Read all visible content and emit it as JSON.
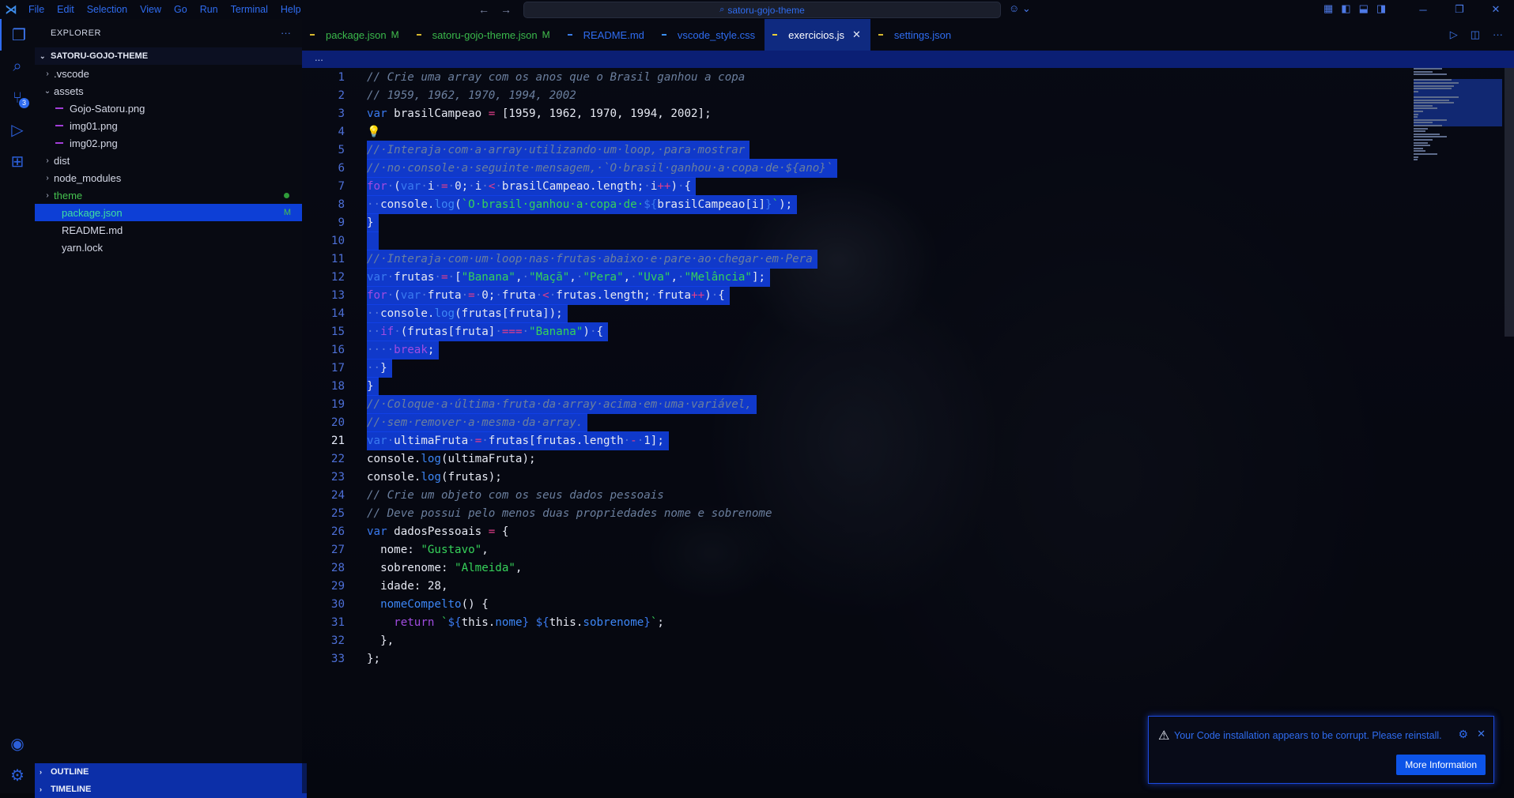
{
  "titlebar": {
    "menu": [
      "File",
      "Edit",
      "Selection",
      "View",
      "Go",
      "Run",
      "Terminal",
      "Help"
    ],
    "search": "satoru-gojo-theme"
  },
  "sidebar": {
    "title": "EXPLORER",
    "root": "SATORU-GOJO-THEME",
    "items": [
      {
        "label": ".vscode",
        "type": "folder",
        "depth": 0,
        "expanded": false
      },
      {
        "label": "assets",
        "type": "folder",
        "depth": 0,
        "expanded": true
      },
      {
        "label": "Gojo-Satoru.png",
        "type": "file",
        "depth": 1
      },
      {
        "label": "img01.png",
        "type": "file",
        "depth": 1
      },
      {
        "label": "img02.png",
        "type": "file",
        "depth": 1
      },
      {
        "label": "dist",
        "type": "folder",
        "depth": 0,
        "expanded": false
      },
      {
        "label": "node_modules",
        "type": "folder",
        "depth": 0,
        "expanded": false
      },
      {
        "label": "theme",
        "type": "folder",
        "depth": 0,
        "expanded": false,
        "modified": true
      },
      {
        "label": "package.json",
        "type": "file",
        "depth": 0,
        "status": "M",
        "selected": true
      },
      {
        "label": "README.md",
        "type": "file",
        "depth": 0
      },
      {
        "label": "yarn.lock",
        "type": "file",
        "depth": 0
      }
    ],
    "outline": "OUTLINE",
    "timeline": "TIMELINE"
  },
  "activity": {
    "scm_badge": "3"
  },
  "tabs": [
    {
      "label": "package.json",
      "status": "M",
      "kind": "json",
      "modified": true
    },
    {
      "label": "satoru-gojo-theme.json",
      "status": "M",
      "kind": "json",
      "modified": true
    },
    {
      "label": "README.md",
      "status": "",
      "kind": "md"
    },
    {
      "label": "vscode_style.css",
      "status": "",
      "kind": "css"
    },
    {
      "label": "exercicios.js",
      "status": "",
      "kind": "js",
      "active": true
    },
    {
      "label": "settings.json",
      "status": "",
      "kind": "json"
    }
  ],
  "breadcrumb": "...",
  "editor": {
    "current_line": 21,
    "lines": [
      {
        "n": 1,
        "tokens": [
          [
            "c-cmt",
            "// Crie uma array com os anos que o Brasil ganhou a copa"
          ]
        ]
      },
      {
        "n": 2,
        "tokens": [
          [
            "c-cmt",
            "// 1959, 1962, 1970, 1994, 2002"
          ]
        ]
      },
      {
        "n": 3,
        "tokens": [
          [
            "c-kwb",
            "var"
          ],
          [
            "c-var",
            " brasilCampeao "
          ],
          [
            "c-op",
            "="
          ],
          [
            "c-var",
            " [1959, 1962, 1970, 1994, 2002];"
          ]
        ]
      },
      {
        "n": 4,
        "tokens": [
          [
            "bulb",
            "💡"
          ]
        ]
      },
      {
        "n": 5,
        "sel": true,
        "tokens": [
          [
            "c-cmt",
            "//·Interaja·com·a·array·utilizando·um·loop,·para·mostrar"
          ]
        ]
      },
      {
        "n": 6,
        "sel": true,
        "tokens": [
          [
            "c-cmt",
            "//·no·console·a·seguinte·mensagem,·`O·brasil·ganhou·a·copa·de·${ano}`"
          ]
        ]
      },
      {
        "n": 7,
        "sel": true,
        "tokens": [
          [
            "c-kw",
            "for"
          ],
          [
            "c-ws",
            "·"
          ],
          [
            "c-var",
            "("
          ],
          [
            "c-kwb",
            "var"
          ],
          [
            "c-ws",
            "·"
          ],
          [
            "c-var",
            "i"
          ],
          [
            "c-ws",
            "·"
          ],
          [
            "c-op",
            "="
          ],
          [
            "c-ws",
            "·"
          ],
          [
            "c-num",
            "0;"
          ],
          [
            "c-ws",
            "·"
          ],
          [
            "c-var",
            "i"
          ],
          [
            "c-ws",
            "·"
          ],
          [
            "c-op",
            "<"
          ],
          [
            "c-ws",
            "·"
          ],
          [
            "c-var",
            "brasilCampeao.length;"
          ],
          [
            "c-ws",
            "·"
          ],
          [
            "c-var",
            "i"
          ],
          [
            "c-op",
            "++"
          ],
          [
            "c-var",
            ")"
          ],
          [
            "c-ws",
            "·"
          ],
          [
            "c-var",
            "{"
          ]
        ]
      },
      {
        "n": 8,
        "sel": true,
        "tokens": [
          [
            "c-ws",
            "··"
          ],
          [
            "c-var",
            "console."
          ],
          [
            "c-fn",
            "log"
          ],
          [
            "c-var",
            "("
          ],
          [
            "c-str",
            "`O·brasil·ganhou·a·copa·de·"
          ],
          [
            "c-kwb",
            "${"
          ],
          [
            "c-var",
            "brasilCampeao[i]"
          ],
          [
            "c-kwb",
            "}"
          ],
          [
            "c-str",
            "`"
          ],
          [
            "c-var",
            ");"
          ]
        ]
      },
      {
        "n": 9,
        "sel": true,
        "tokens": [
          [
            "c-var",
            "}"
          ]
        ]
      },
      {
        "n": 10,
        "sel": true,
        "tokens": [
          [
            "c-var",
            " "
          ]
        ]
      },
      {
        "n": 11,
        "sel": true,
        "tokens": [
          [
            "c-cmt",
            "//·Interaja·com·um·loop·nas·frutas·abaixo·e·pare·ao·chegar·em·Pera"
          ]
        ]
      },
      {
        "n": 12,
        "sel": true,
        "tokens": [
          [
            "c-kwb",
            "var"
          ],
          [
            "c-ws",
            "·"
          ],
          [
            "c-var",
            "frutas"
          ],
          [
            "c-ws",
            "·"
          ],
          [
            "c-op",
            "="
          ],
          [
            "c-ws",
            "·"
          ],
          [
            "c-var",
            "["
          ],
          [
            "c-str",
            "\"Banana\""
          ],
          [
            "c-var",
            ","
          ],
          [
            "c-ws",
            "·"
          ],
          [
            "c-str",
            "\"Maçã\""
          ],
          [
            "c-var",
            ","
          ],
          [
            "c-ws",
            "·"
          ],
          [
            "c-str",
            "\"Pera\""
          ],
          [
            "c-var",
            ","
          ],
          [
            "c-ws",
            "·"
          ],
          [
            "c-str",
            "\"Uva\""
          ],
          [
            "c-var",
            ","
          ],
          [
            "c-ws",
            "·"
          ],
          [
            "c-str",
            "\"Melância\""
          ],
          [
            "c-var",
            "];"
          ]
        ]
      },
      {
        "n": 13,
        "sel": true,
        "tokens": [
          [
            "c-kw",
            "for"
          ],
          [
            "c-ws",
            "·"
          ],
          [
            "c-var",
            "("
          ],
          [
            "c-kwb",
            "var"
          ],
          [
            "c-ws",
            "·"
          ],
          [
            "c-var",
            "fruta"
          ],
          [
            "c-ws",
            "·"
          ],
          [
            "c-op",
            "="
          ],
          [
            "c-ws",
            "·"
          ],
          [
            "c-num",
            "0;"
          ],
          [
            "c-ws",
            "·"
          ],
          [
            "c-var",
            "fruta"
          ],
          [
            "c-ws",
            "·"
          ],
          [
            "c-op",
            "<"
          ],
          [
            "c-ws",
            "·"
          ],
          [
            "c-var",
            "frutas.length;"
          ],
          [
            "c-ws",
            "·"
          ],
          [
            "c-var",
            "fruta"
          ],
          [
            "c-op",
            "++"
          ],
          [
            "c-var",
            ")"
          ],
          [
            "c-ws",
            "·"
          ],
          [
            "c-var",
            "{"
          ]
        ]
      },
      {
        "n": 14,
        "sel": true,
        "tokens": [
          [
            "c-ws",
            "··"
          ],
          [
            "c-var",
            "console."
          ],
          [
            "c-fn",
            "log"
          ],
          [
            "c-var",
            "(frutas[fruta]);"
          ]
        ]
      },
      {
        "n": 15,
        "sel": true,
        "tokens": [
          [
            "c-ws",
            "··"
          ],
          [
            "c-kw",
            "if"
          ],
          [
            "c-ws",
            "·"
          ],
          [
            "c-var",
            "(frutas[fruta]"
          ],
          [
            "c-ws",
            "·"
          ],
          [
            "c-op",
            "==="
          ],
          [
            "c-ws",
            "·"
          ],
          [
            "c-str",
            "\"Banana\""
          ],
          [
            "c-var",
            ")"
          ],
          [
            "c-ws",
            "·"
          ],
          [
            "c-var",
            "{"
          ]
        ]
      },
      {
        "n": 16,
        "sel": true,
        "tokens": [
          [
            "c-ws",
            "····"
          ],
          [
            "c-kw",
            "break"
          ],
          [
            "c-var",
            ";"
          ]
        ]
      },
      {
        "n": 17,
        "sel": true,
        "tokens": [
          [
            "c-ws",
            "··"
          ],
          [
            "c-var",
            "}"
          ]
        ]
      },
      {
        "n": 18,
        "sel": true,
        "tokens": [
          [
            "c-var",
            "}"
          ]
        ]
      },
      {
        "n": 19,
        "sel": true,
        "tokens": [
          [
            "c-cmt",
            "//·Coloque·a·última·fruta·da·array·acima·em·uma·variável,"
          ]
        ]
      },
      {
        "n": 20,
        "sel": true,
        "tokens": [
          [
            "c-cmt",
            "//·sem·remover·a·mesma·da·array."
          ]
        ]
      },
      {
        "n": 21,
        "sel": true,
        "tokens": [
          [
            "c-kwb",
            "var"
          ],
          [
            "c-ws",
            "·"
          ],
          [
            "c-var",
            "ultimaFruta"
          ],
          [
            "c-ws",
            "·"
          ],
          [
            "c-op",
            "="
          ],
          [
            "c-ws",
            "·"
          ],
          [
            "c-var",
            "frutas[frutas.length"
          ],
          [
            "c-ws",
            "·"
          ],
          [
            "c-op",
            "-"
          ],
          [
            "c-ws",
            "·"
          ],
          [
            "c-num",
            "1];"
          ]
        ]
      },
      {
        "n": 22,
        "tokens": [
          [
            "c-var",
            "console."
          ],
          [
            "c-fn",
            "log"
          ],
          [
            "c-var",
            "(ultimaFruta);"
          ]
        ]
      },
      {
        "n": 23,
        "tokens": [
          [
            "c-var",
            "console."
          ],
          [
            "c-fn",
            "log"
          ],
          [
            "c-var",
            "(frutas);"
          ]
        ]
      },
      {
        "n": 24,
        "tokens": [
          [
            "c-cmt",
            "// Crie um objeto com os seus dados pessoais"
          ]
        ]
      },
      {
        "n": 25,
        "tokens": [
          [
            "c-cmt",
            "// Deve possui pelo menos duas propriedades nome e sobrenome"
          ]
        ]
      },
      {
        "n": 26,
        "tokens": [
          [
            "c-kwb",
            "var"
          ],
          [
            "c-var",
            " dadosPessoais "
          ],
          [
            "c-op",
            "="
          ],
          [
            "c-var",
            " {"
          ]
        ]
      },
      {
        "n": 27,
        "tokens": [
          [
            "c-var",
            "  nome: "
          ],
          [
            "c-str",
            "\"Gustavo\""
          ],
          [
            "c-var",
            ","
          ]
        ]
      },
      {
        "n": 28,
        "tokens": [
          [
            "c-var",
            "  sobrenome: "
          ],
          [
            "c-str",
            "\"Almeida\""
          ],
          [
            "c-var",
            ","
          ]
        ]
      },
      {
        "n": 29,
        "tokens": [
          [
            "c-var",
            "  idade: 28,"
          ]
        ]
      },
      {
        "n": 30,
        "tokens": [
          [
            "c-var",
            "  "
          ],
          [
            "c-fn",
            "nomeCompelto"
          ],
          [
            "c-var",
            "() {"
          ]
        ]
      },
      {
        "n": 31,
        "tokens": [
          [
            "c-var",
            "    "
          ],
          [
            "c-kw",
            "return"
          ],
          [
            "c-var",
            " "
          ],
          [
            "c-str",
            "`"
          ],
          [
            "c-kwb",
            "${"
          ],
          [
            "c-var",
            "this"
          ],
          [
            "c-var",
            "."
          ],
          [
            "c-fn",
            "nome"
          ],
          [
            "c-kwb",
            "}"
          ],
          [
            "c-str",
            " "
          ],
          [
            "c-kwb",
            "${"
          ],
          [
            "c-var",
            "this"
          ],
          [
            "c-var",
            "."
          ],
          [
            "c-fn",
            "sobrenome"
          ],
          [
            "c-kwb",
            "}"
          ],
          [
            "c-str",
            "`"
          ],
          [
            "c-var",
            ";"
          ]
        ]
      },
      {
        "n": 32,
        "tokens": [
          [
            "c-var",
            "  },"
          ]
        ]
      },
      {
        "n": 33,
        "tokens": [
          [
            "c-var",
            "};"
          ]
        ]
      }
    ]
  },
  "notification": {
    "message": "Your Code installation appears to be corrupt. Please reinstall.",
    "button": "More Information"
  },
  "colors": {
    "accent": "#2f6cf0",
    "selection": "#1242eb",
    "string": "#36d25a",
    "keyword": "#a04ce0",
    "operator": "#e23e8a"
  }
}
